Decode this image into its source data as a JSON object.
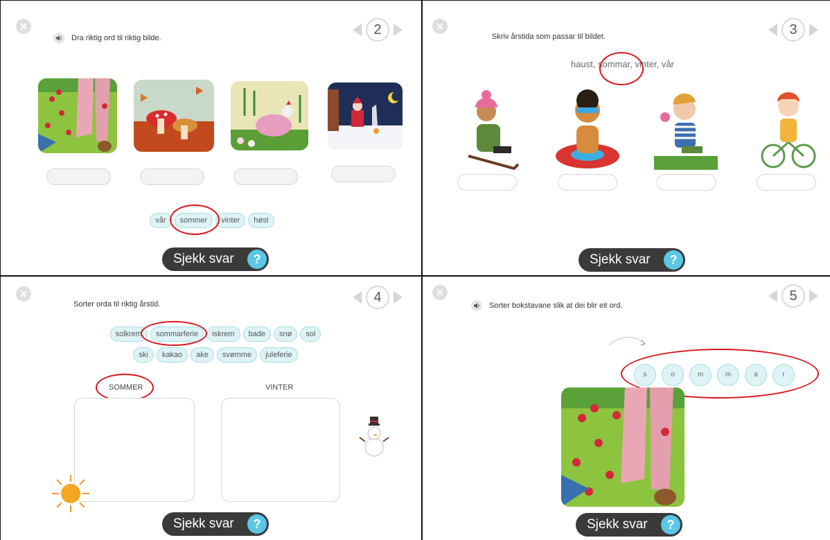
{
  "panel2": {
    "page_number": "2",
    "instruction": "Dra riktig ord til riktig bilde.",
    "words": [
      "vår",
      "sommer",
      "vinter",
      "høst"
    ],
    "check_label": "Sjekk svar",
    "help_label": "?"
  },
  "panel3": {
    "page_number": "3",
    "instruction": "Skriv årstida som passar til bildet.",
    "word_bank": [
      "haust,",
      "sommar,",
      "vinter,",
      "vår"
    ],
    "check_label": "Sjekk svar",
    "help_label": "?"
  },
  "panel4": {
    "page_number": "4",
    "instruction": "Sorter orda til riktig årstid.",
    "words_row1": [
      "solkrem",
      "sommarferie",
      "iskrem",
      "bade",
      "snø",
      "sol"
    ],
    "words_row2": [
      "ski",
      "kakao",
      "ake",
      "svømme",
      "juleferie"
    ],
    "column_left": "SOMMER",
    "column_right": "VINTER",
    "check_label": "Sjekk svar",
    "help_label": "?"
  },
  "panel5": {
    "page_number": "5",
    "instruction": "Sorter bokstavane slik at dei blir eit ord.",
    "letters": [
      "s",
      "o",
      "m",
      "m",
      "a",
      "r"
    ],
    "check_label": "Sjekk svar",
    "help_label": "?"
  },
  "colors": {
    "highlight_ring": "#d9141c",
    "chip_fill": "#ddf3f6",
    "help_button": "#5bc6e6",
    "check_button": "#3a3a3a"
  }
}
